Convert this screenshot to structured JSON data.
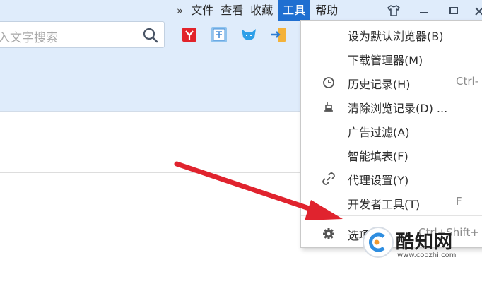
{
  "menubar": {
    "chevron": "»",
    "items": [
      "文件",
      "查看",
      "收藏",
      "工具",
      "帮助"
    ],
    "active": "工具"
  },
  "search": {
    "placeholder": "入文字搜索",
    "icon": "search-icon"
  },
  "extensions": [
    {
      "name": "ext-red-icon",
      "color": "#e2232a"
    },
    {
      "name": "ext-translate-icon",
      "color": "#4a90d9",
      "glyph": "译"
    },
    {
      "name": "ext-cat-icon",
      "color": "#2d9fe8"
    },
    {
      "name": "ext-login-icon",
      "color": "#f0a020"
    }
  ],
  "tools_menu": {
    "items": [
      {
        "label": "设为默认浏览器(B)",
        "shortcut": "",
        "icon": ""
      },
      {
        "label": "下载管理器(M)",
        "shortcut": "",
        "icon": ""
      },
      {
        "label": "历史记录(H)",
        "shortcut": "Ctrl-",
        "icon": "clock-icon"
      },
      {
        "label": "清除浏览记录(D) ...",
        "shortcut": "",
        "icon": "eraser-icon"
      },
      {
        "label": "广告过滤(A)",
        "shortcut": "",
        "icon": ""
      },
      {
        "label": "智能填表(F)",
        "shortcut": "",
        "icon": ""
      },
      {
        "label": "代理设置(Y)",
        "shortcut": "",
        "icon": "link-icon"
      },
      {
        "label": "开发者工具(T)",
        "shortcut": "F",
        "icon": ""
      },
      {
        "label": "选项(O)",
        "shortcut": "Ctrl+Shift+",
        "icon": "gear-icon"
      }
    ]
  },
  "watermark": {
    "brand": "酷知网",
    "url": "www.coozhi.com"
  },
  "colors": {
    "chrome_bg": "#dfecfb",
    "active_menu": "#1f6fd1",
    "arrow": "#e0232e"
  }
}
